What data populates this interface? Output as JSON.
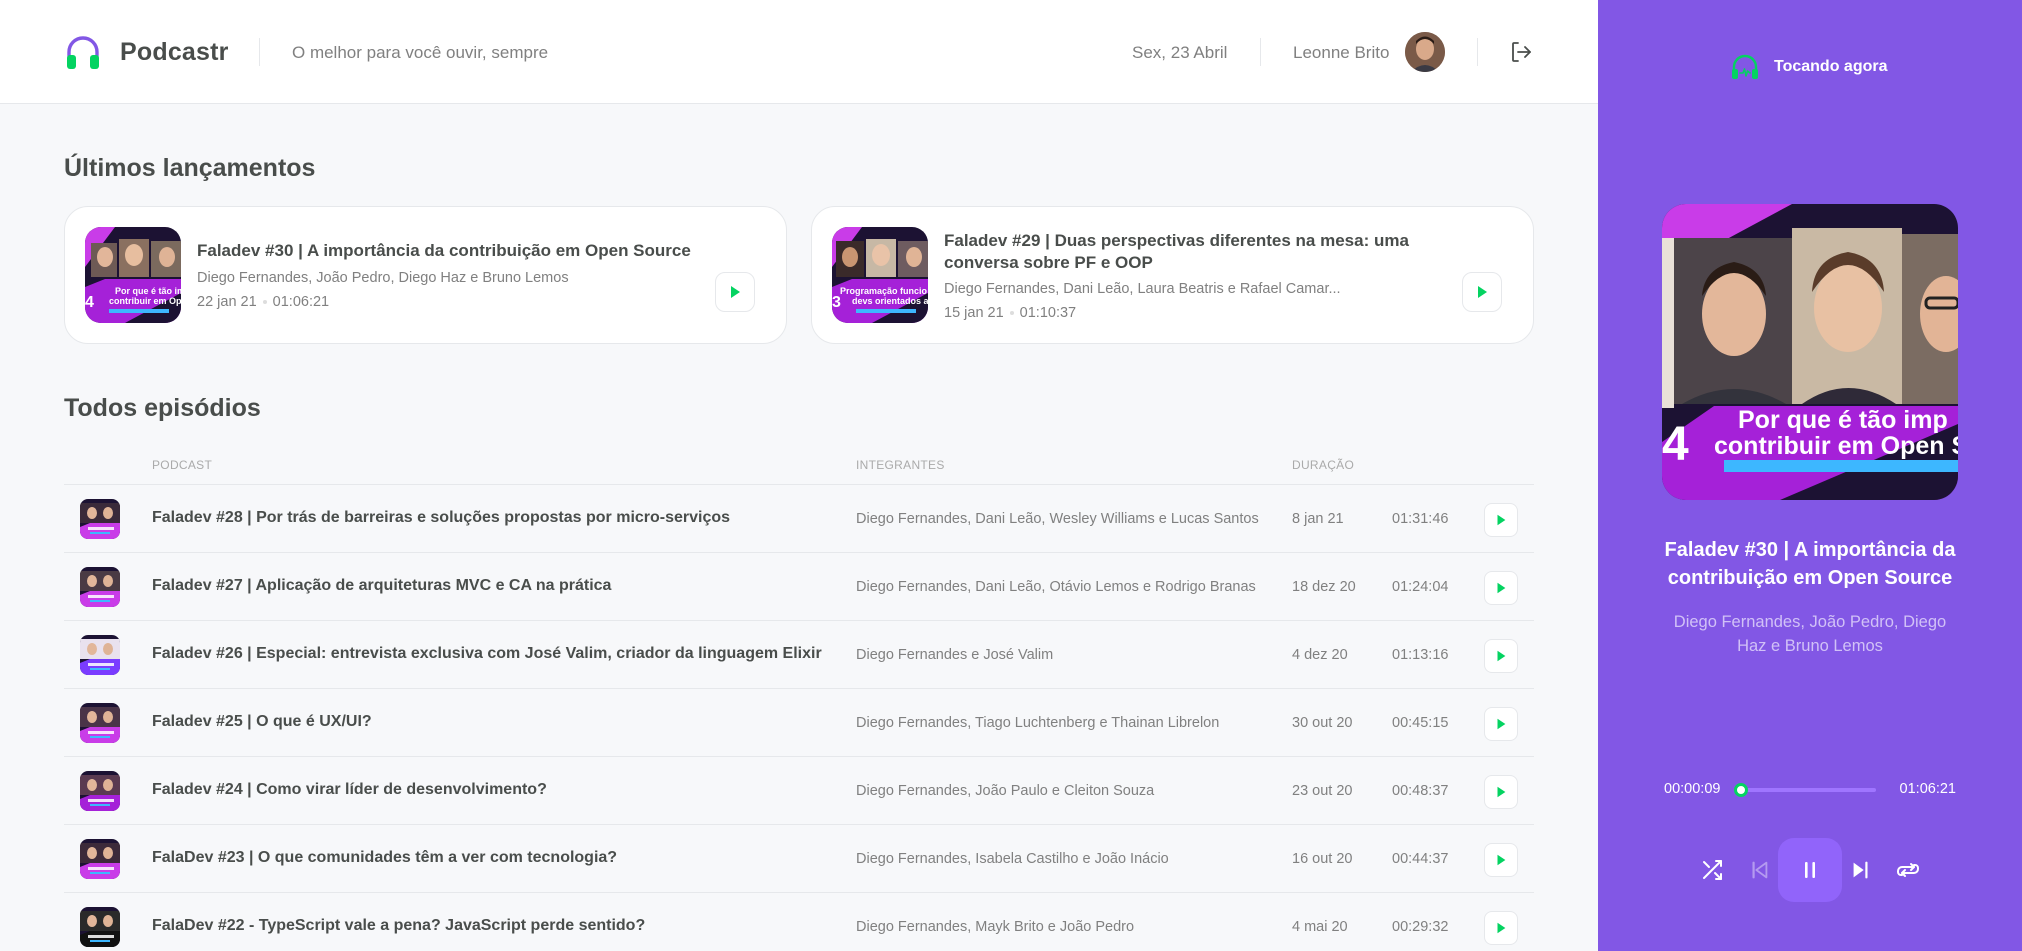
{
  "colors": {
    "brand": "#8257e5",
    "green": "#04d361",
    "text": "#494d4b",
    "muted": "#808080"
  },
  "header": {
    "brand": "Podcastr",
    "tagline": "O melhor para você ouvir, sempre",
    "date": "Sex, 23 Abril",
    "user": "Leonne Brito"
  },
  "latest": {
    "title": "Últimos lançamentos",
    "items": [
      {
        "title": "Faladev #30 | A importância da contribuição em Open Source",
        "members": "Diego Fernandes, João Pedro, Diego Haz e Bruno Lemos",
        "date": "22 jan 21",
        "duration": "01:06:21",
        "thumb_line1": "Por que é tão imp",
        "thumb_line2": "contribuir em Open S",
        "thumb_num": "4"
      },
      {
        "title": "Faladev #29 | Duas perspectivas diferentes na mesa: uma conversa sobre PF e OOP",
        "members": "Diego Fernandes, Dani Leão, Laura Beatris e Rafael Camar...",
        "date": "15 jan 21",
        "duration": "01:10:37",
        "thumb_line1": "Programação funcio",
        "thumb_line2": "devs orientados a o",
        "thumb_num": "3"
      }
    ]
  },
  "all": {
    "title": "Todos episódios",
    "columns": {
      "podcast": "PODCAST",
      "members": "INTEGRANTES",
      "duration": "DURAÇÃO"
    },
    "rows": [
      {
        "title": "Faladev #28 | Por trás de barreiras e soluções propostas por micro-serviços",
        "members": "Diego Fernandes, Dani Leão, Wesley Williams e Lucas Santos",
        "date": "8 jan 21",
        "duration": "01:31:46"
      },
      {
        "title": "Faladev #27 | Aplicação de arquiteturas MVC e CA na prática",
        "members": "Diego Fernandes, Dani Leão, Otávio Lemos e Rodrigo Branas",
        "date": "18 dez 20",
        "duration": "01:24:04"
      },
      {
        "title": "Faladev #26 | Especial: entrevista exclusiva com José Valim, criador da linguagem Elixir",
        "members": "Diego Fernandes e José Valim",
        "date": "4 dez 20",
        "duration": "01:13:16"
      },
      {
        "title": "Faladev #25 | O que é UX/UI?",
        "members": "Diego Fernandes, Tiago Luchtenberg e Thainan Librelon",
        "date": "30 out 20",
        "duration": "00:45:15"
      },
      {
        "title": "Faladev #24 | Como virar líder de desenvolvimento?",
        "members": "Diego Fernandes, João Paulo e Cleiton Souza",
        "date": "23 out 20",
        "duration": "00:48:37"
      },
      {
        "title": "FalaDev #23 | O que comunidades têm a ver com tecnologia?",
        "members": "Diego Fernandes, Isabela Castilho e João Inácio",
        "date": "16 out 20",
        "duration": "00:44:37"
      },
      {
        "title": "FalaDev #22 - TypeScript vale a pena? JavaScript perde sentido?",
        "members": "Diego Fernandes, Mayk Brito e João Pedro",
        "date": "4 mai 20",
        "duration": "00:29:32"
      }
    ]
  },
  "player": {
    "label": "Tocando agora",
    "title": "Faladev #30 | A importância da contribuição em Open Source",
    "members": "Diego Fernandes, João Pedro, Diego Haz e Bruno Lemos",
    "current": "00:00:09",
    "total": "01:06:21",
    "progress": 0.02,
    "cover_line1": "Por que é tão imp",
    "cover_line2": "contribuir em Open S",
    "cover_num": "4"
  }
}
